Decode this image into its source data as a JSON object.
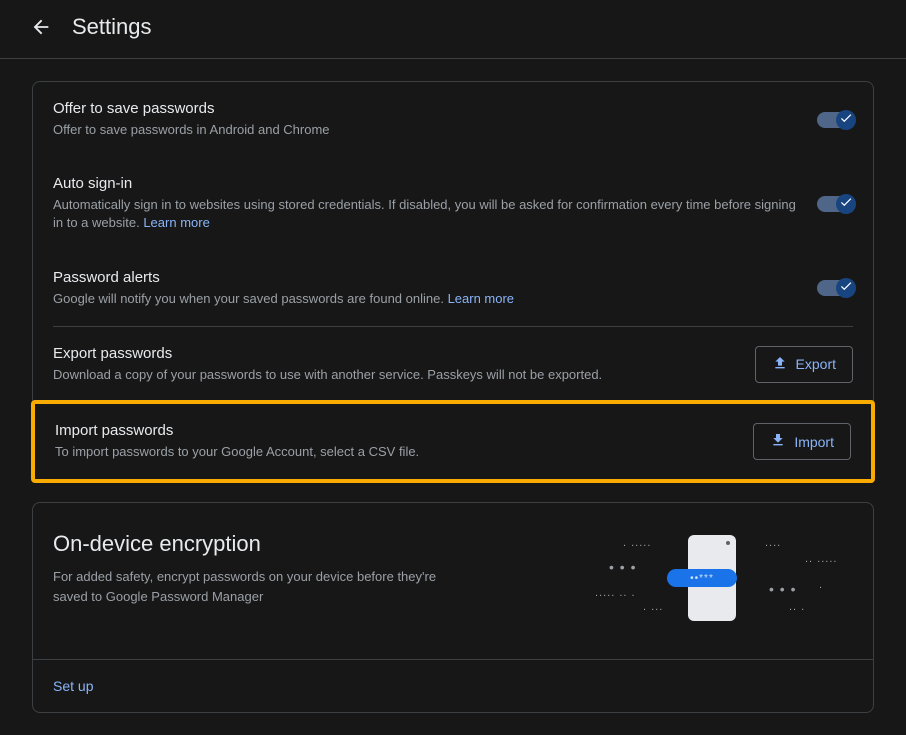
{
  "header": {
    "title": "Settings"
  },
  "settings": {
    "offerSave": {
      "title": "Offer to save passwords",
      "desc": "Offer to save passwords in Android and Chrome",
      "on": true
    },
    "autoSignin": {
      "title": "Auto sign-in",
      "desc": "Automatically sign in to websites using stored credentials. If disabled, you will be asked for confirmation every time before signing in to a website. ",
      "learnMore": "Learn more",
      "on": true
    },
    "passwordAlerts": {
      "title": "Password alerts",
      "desc": "Google will notify you when your saved passwords are found online. ",
      "learnMore": "Learn more",
      "on": true
    },
    "export": {
      "title": "Export passwords",
      "desc": "Download a copy of your passwords to use with another service. Passkeys will not be exported.",
      "button": "Export"
    },
    "import": {
      "title": "Import passwords",
      "desc": "To import passwords to your Google Account, select a CSV file.",
      "button": "Import"
    }
  },
  "encryption": {
    "title": "On-device encryption",
    "desc": "For added safety, encrypt passwords on your device before they're saved to Google Password Manager",
    "setup": "Set up"
  }
}
